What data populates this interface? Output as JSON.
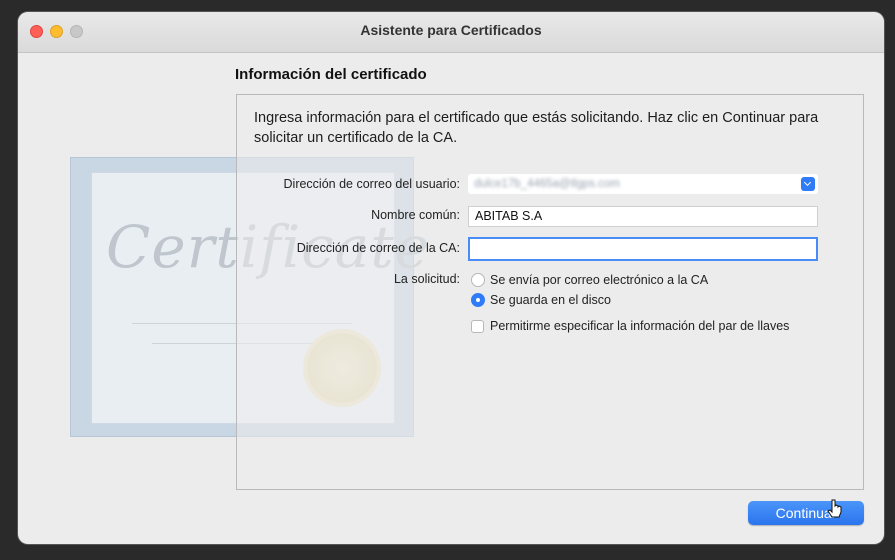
{
  "window": {
    "title": "Asistente para Certificados"
  },
  "section": {
    "heading": "Información del certificado",
    "intro": "Ingresa información para el certificado que estás solicitando. Haz clic en Continuar para solicitar un certificado de la CA."
  },
  "background": {
    "certificate_text": "Certificate"
  },
  "form": {
    "user_email_label": "Dirección de correo del usuario:",
    "user_email_value": "dulce17b_4465a@tlgps.com",
    "common_name_label": "Nombre común:",
    "common_name_value": "ABITAB S.A",
    "ca_email_label": "Dirección de correo de la CA:",
    "ca_email_value": "",
    "request_label": "La solicitud:",
    "option_email": "Se envía por correo electrónico a la CA",
    "option_disk": "Se guarda en el disco",
    "option_keypair": "Permitirme especificar la información del par de llaves",
    "selected_option": "option_disk",
    "keypair_checked": false
  },
  "buttons": {
    "continue_label": "Continuar"
  },
  "colors": {
    "accent": "#2f7cf6",
    "close": "#fe5f57",
    "minimize": "#febc2e",
    "maximize": "#c8c8c8"
  }
}
